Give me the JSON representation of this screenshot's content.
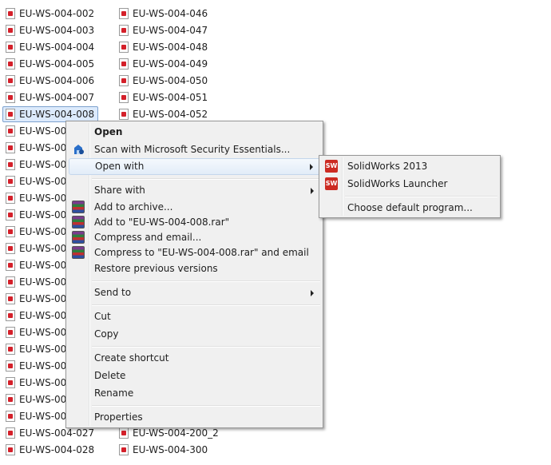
{
  "files_left": [
    "EU-WS-004-002",
    "EU-WS-004-003",
    "EU-WS-004-004",
    "EU-WS-004-005",
    "EU-WS-004-006",
    "EU-WS-004-007",
    "EU-WS-004-008",
    "EU-WS-004",
    "EU-WS-004",
    "EU-WS-004",
    "EU-WS-004",
    "EU-WS-004",
    "EU-WS-004",
    "EU-WS-004",
    "EU-WS-004",
    "EU-WS-004",
    "EU-WS-004",
    "EU-WS-004",
    "EU-WS-004",
    "EU-WS-004",
    "EU-WS-004",
    "EU-WS-004",
    "EU-WS-004",
    "EU-WS-004",
    "EU-WS-004",
    "EU-WS-004-027",
    "EU-WS-004-028"
  ],
  "files_right": [
    "EU-WS-004-046",
    "EU-WS-004-047",
    "EU-WS-004-048",
    "EU-WS-004-049",
    "EU-WS-004-050",
    "EU-WS-004-051",
    "EU-WS-004-052"
  ],
  "files_right_bottom": [
    "EU-WS-004-200_2",
    "EU-WS-004-300"
  ],
  "context_menu": {
    "open": "Open",
    "scan": "Scan with Microsoft Security Essentials...",
    "open_with": "Open with",
    "share_with": "Share with",
    "add_to_archive": "Add to archive...",
    "add_to_rar": "Add to \"EU-WS-004-008.rar\"",
    "compress_email": "Compress and email...",
    "compress_rar_email": "Compress to \"EU-WS-004-008.rar\" and email",
    "restore": "Restore previous versions",
    "send_to": "Send to",
    "cut": "Cut",
    "copy": "Copy",
    "create_shortcut": "Create shortcut",
    "delete": "Delete",
    "rename": "Rename",
    "properties": "Properties"
  },
  "submenu": {
    "solidworks_2013": "SolidWorks 2013",
    "solidworks_launcher": "SolidWorks Launcher",
    "choose_default": "Choose default program..."
  },
  "icons": {
    "file": "solidworks-file-icon",
    "sw": "SW"
  }
}
